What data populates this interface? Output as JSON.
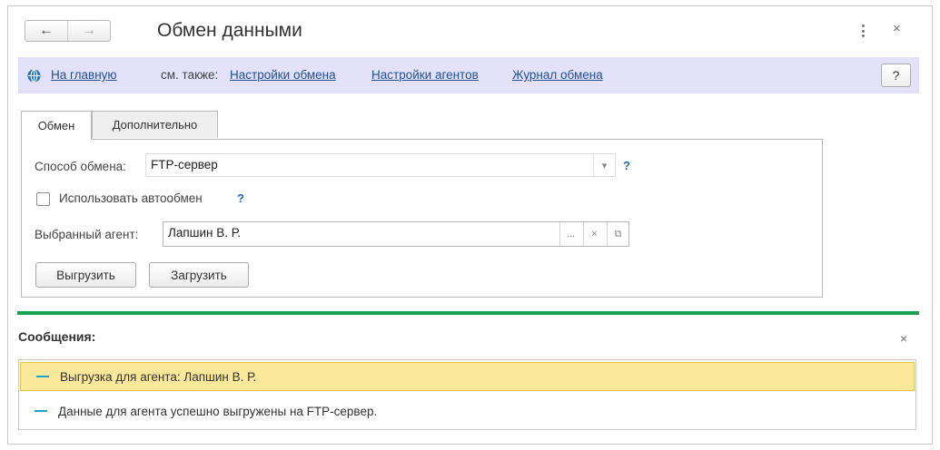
{
  "window": {
    "title": "Обмен данными",
    "nav": {
      "back_icon": "←",
      "forward_icon": "→"
    },
    "more_icon": "vertical-dots",
    "close_icon": "×"
  },
  "command_bar": {
    "home_link": "На главную",
    "see_also": "см. также:",
    "links": [
      "Настройки обмена",
      "Настройки агентов",
      "Журнал обмена"
    ],
    "help_label": "?"
  },
  "tabs": [
    {
      "label": "Обмен",
      "active": true
    },
    {
      "label": "Дополнительно",
      "active": false
    }
  ],
  "form": {
    "exchange_method_label": "Способ обмена:",
    "exchange_method_value": "FTP-сервер",
    "help_mark": "?",
    "autoexchange_label": "Использовать автообмен",
    "autoexchange_checked": false,
    "agent_label": "Выбранный агент:",
    "agent_value": "Лапшин В. Р.",
    "agent_buttons": [
      "...",
      "×",
      "⧉"
    ],
    "export_button": "Выгрузить",
    "import_button": "Загрузить"
  },
  "messages": {
    "title": "Сообщения:",
    "close_icon": "×",
    "items": [
      "Выгрузка для агента: Лапшин В. Р.",
      "Данные для агента успешно выгружены на FTP-сервер."
    ]
  },
  "colors": {
    "command_bar_bg": "#e4e2fb",
    "link": "#1f4f9a",
    "accent_green": "#19a14d",
    "selected_row": "#fce89b"
  }
}
